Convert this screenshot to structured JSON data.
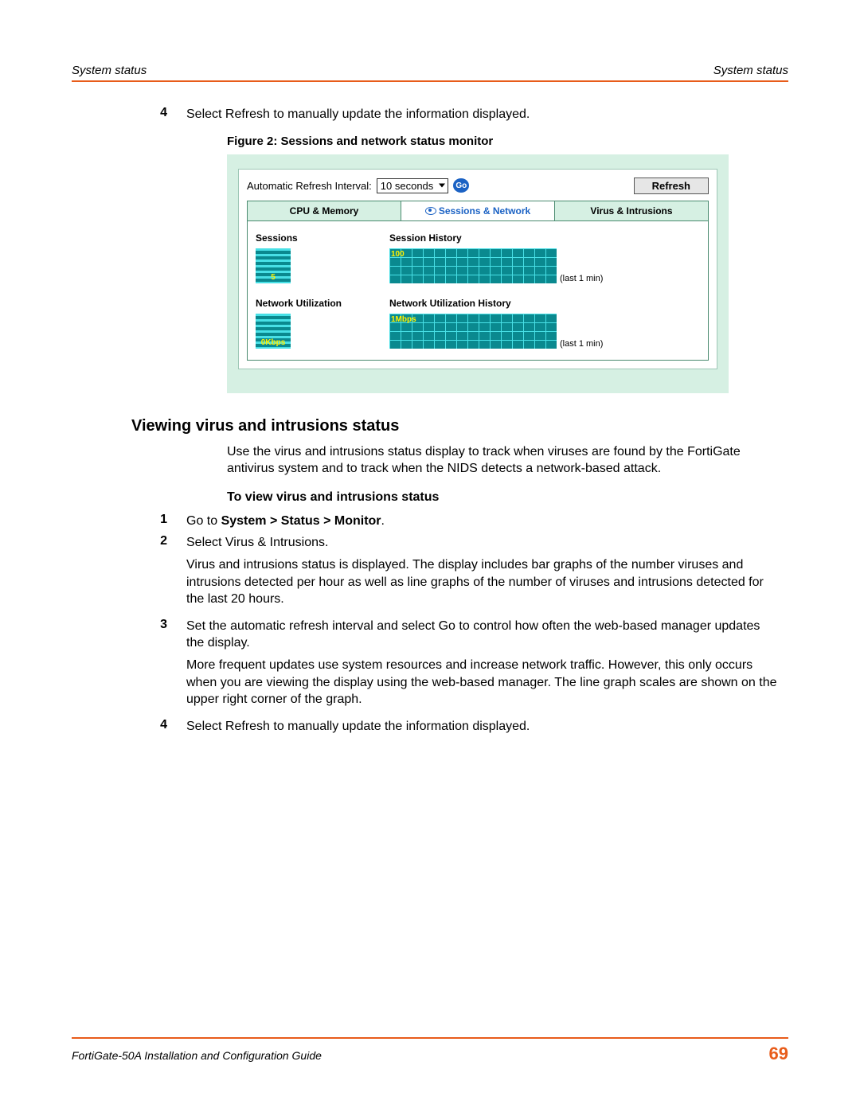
{
  "header": {
    "left": "System status",
    "right": "System status"
  },
  "step4a": {
    "num": "4",
    "text": "Select Refresh to manually update the information displayed."
  },
  "figure_caption": "Figure 2:  Sessions and network status monitor",
  "monitor": {
    "refresh_label": "Automatic Refresh Interval:",
    "interval_value": "10 seconds",
    "go_label": "Go",
    "refresh_button": "Refresh",
    "tabs": {
      "cpu": "CPU & Memory",
      "sessions": "Sessions & Network",
      "virus": "Virus & Intrusions"
    },
    "sessions_title": "Sessions",
    "sessions_value": "5",
    "session_history_title": "Session History",
    "session_history_scale": "100",
    "session_history_last": "(last 1 min)",
    "netutil_title": "Network Utilization",
    "netutil_value": "0Kbps",
    "netutil_history_title": "Network Utilization History",
    "netutil_history_scale": "1Mbps",
    "netutil_history_last": "(last 1 min)"
  },
  "section_heading": "Viewing virus and intrusions status",
  "intro_para": "Use the virus and intrusions status display to track when viruses are found by the FortiGate antivirus system and to track when the NIDS detects a network-based attack.",
  "sub_heading": "To view virus and intrusions status",
  "steps": {
    "s1": {
      "num": "1",
      "text_pre": "Go to ",
      "bold": "System > Status > Monitor",
      "text_post": "."
    },
    "s2": {
      "num": "2",
      "line1": "Select Virus & Intrusions.",
      "line2": "Virus and intrusions status is displayed. The display includes bar graphs of the number viruses and intrusions detected per hour as well as line graphs of the number of viruses and intrusions detected for the last 20 hours."
    },
    "s3": {
      "num": "3",
      "line1": "Set the automatic refresh interval and select Go to control how often the web-based manager updates the display.",
      "line2": "More frequent updates use system resources and increase network traffic. However, this only occurs when you are viewing the display using the web-based manager. The line graph scales are shown on the upper right corner of the graph."
    },
    "s4": {
      "num": "4",
      "text": "Select Refresh to manually update the information displayed."
    }
  },
  "footer": {
    "title": "FortiGate-50A Installation and Configuration Guide",
    "page": "69"
  }
}
